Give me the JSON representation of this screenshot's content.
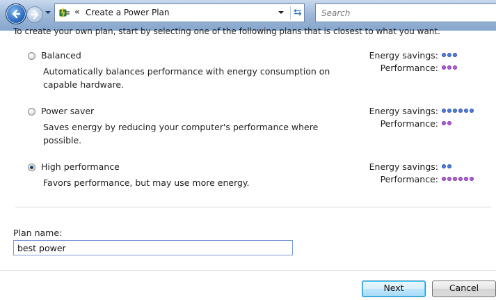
{
  "nav": {
    "back_icon": "back-arrow-icon",
    "forward_icon": "forward-arrow-icon",
    "breadcrumb_chevron": "«",
    "address_text": "Create a Power Plan",
    "search_placeholder": "Search"
  },
  "intro_text": "To create your own plan, start by selecting one of the following plans that is closest to what you want.",
  "plans": [
    {
      "name": "Balanced",
      "description": "Automatically balances performance with energy consumption on capable hardware.",
      "selected": false,
      "energy_label": "Energy savings:",
      "energy_dots": 3,
      "performance_label": "Performance:",
      "performance_dots": 3
    },
    {
      "name": "Power saver",
      "description": "Saves energy by reducing your computer's performance where possible.",
      "selected": false,
      "energy_label": "Energy savings:",
      "energy_dots": 6,
      "performance_label": "Performance:",
      "performance_dots": 2
    },
    {
      "name": "High performance",
      "description": "Favors performance, but may use more energy.",
      "selected": true,
      "energy_label": "Energy savings:",
      "energy_dots": 2,
      "performance_label": "Performance:",
      "performance_dots": 6
    }
  ],
  "plan_name": {
    "label": "Plan name:",
    "value": "best power"
  },
  "buttons": {
    "next": "Next",
    "cancel": "Cancel"
  },
  "colors": {
    "energy_dot": "#4f7fe0",
    "performance_dot": "#b25fd8"
  }
}
